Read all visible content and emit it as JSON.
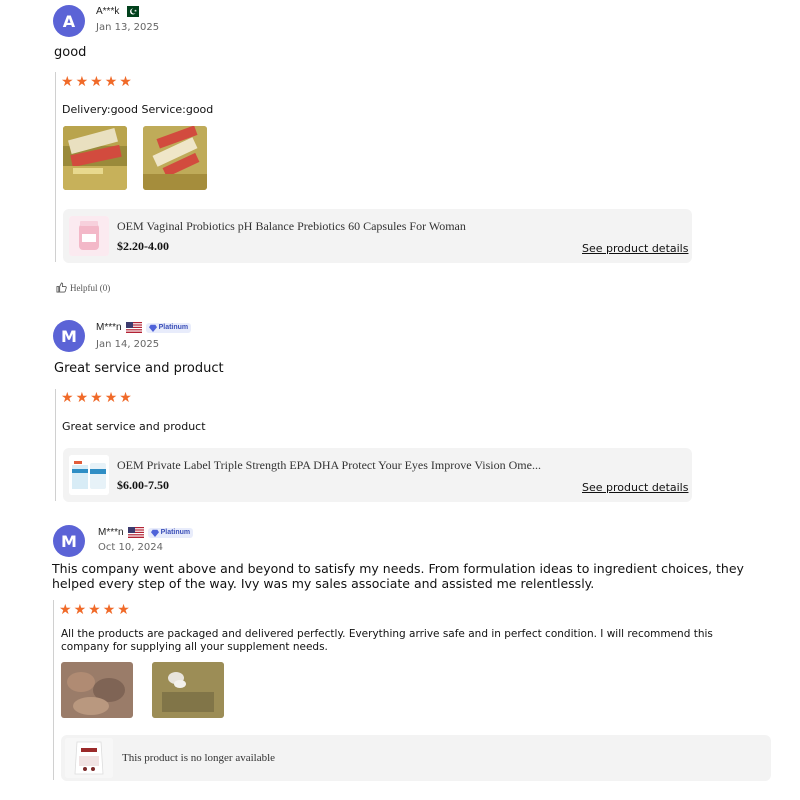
{
  "reviews": [
    {
      "avatar_letter": "A",
      "username": "A***k",
      "country_flag": "pakistan-flag",
      "date": "Jan 13, 2025",
      "headline": "good",
      "rating": 5,
      "body": "Delivery:good Service:good",
      "product": {
        "title": "OEM Vaginal Probiotics pH Balance Prebiotics 60 Capsules For Woman",
        "price": "$2.20-4.00",
        "details_label": "See product details"
      },
      "helpful_label": "Helpful (0)"
    },
    {
      "avatar_letter": "M",
      "username": "M***n",
      "country_flag": "usa-flag",
      "badge": "Platinum",
      "date": "Jan 14, 2025",
      "headline": "Great service and product",
      "rating": 5,
      "body": "Great service and product",
      "product": {
        "title": "OEM Private Label Triple Strength EPA DHA Protect Your Eyes Improve Vision Ome...",
        "price": "$6.00-7.50",
        "details_label": "See product details"
      }
    },
    {
      "avatar_letter": "M",
      "username": "M***n",
      "country_flag": "usa-flag",
      "badge": "Platinum",
      "date": "Oct 10, 2024",
      "headline": "This company went above and beyond to satisfy my needs. From formulation ideas to ingredient choices, they helped every step of the way. Ivy was my sales associate and assisted me relentlessly.",
      "rating": 5,
      "body": "All the products are packaged and delivered perfectly. Everything arrive safe and in perfect condition. I will recommend this company for supplying all your supplement needs.",
      "product": {
        "unavailable_label": "This product is no longer available"
      }
    }
  ],
  "colors": {
    "avatar": "#5b63d6",
    "star": "#f06a29",
    "card_bg": "#f3f3f3"
  }
}
